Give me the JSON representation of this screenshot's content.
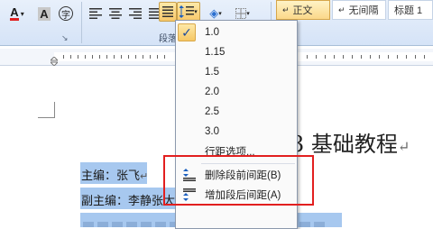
{
  "ribbon": {
    "font_color_label": "A",
    "char_shading_label": "A",
    "enclose_char_label": "字",
    "paragraph_group_label": "段落",
    "styles": [
      "正文",
      "无间隔",
      "标题 1"
    ]
  },
  "menu": {
    "items": [
      {
        "label": "1.0",
        "checked": true
      },
      {
        "label": "1.15"
      },
      {
        "label": "1.5"
      },
      {
        "label": "2.0"
      },
      {
        "label": "2.5"
      },
      {
        "label": "3.0"
      }
    ],
    "options_label": "行距选项...",
    "remove_before_label": "删除段前间距(B)",
    "add_after_label": "增加段后间距(A)"
  },
  "document": {
    "title_partial": "3 基础教程",
    "line1": "主编：张飞",
    "line2": "副主编：李静张大"
  },
  "colors": {
    "accent": "#e21f1f",
    "highlight": "#a7c8ef",
    "ribbon_top": "#e8f0fb",
    "ribbon_bottom": "#d5e3f7"
  }
}
